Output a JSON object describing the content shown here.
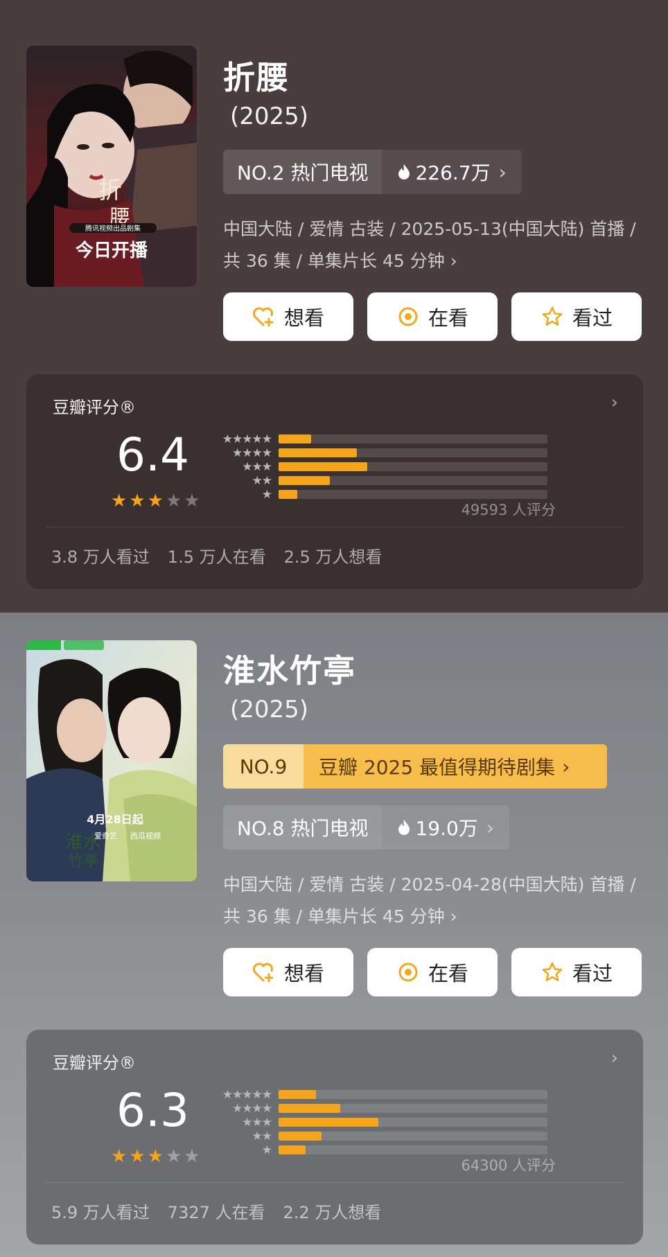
{
  "shows": [
    {
      "title": "折腰",
      "year": "(2025)",
      "poster": {
        "top_label": "腾讯视频出品剧集",
        "bottom_label": "今日开播"
      },
      "rank": {
        "left": "NO.2 热门电视",
        "heat": "226.7万"
      },
      "meta": "中国大陆 / 爱情 古装 / 2025-05-13(中国大陆) 首播 / 共 36 集 / 单集片长 45 分钟",
      "buttons": {
        "want": "想看",
        "watching": "在看",
        "watched": "看过"
      },
      "rating": {
        "header": "豆瓣评分®",
        "score": "6.4",
        "stars_filled": 3,
        "distribution": [
          0.12,
          0.29,
          0.33,
          0.19,
          0.07
        ],
        "votes": "49593 人评分",
        "watched": "3.8 万人看过",
        "watching": "1.5 万人在看",
        "want": "2.5 万人想看"
      }
    },
    {
      "title": "淮水竹亭",
      "year": "(2025)",
      "poster": {
        "date_label": "4月28日起",
        "platform": "爱奇艺",
        "partner": "西瓜视频"
      },
      "expect": {
        "left": "NO.9",
        "right": "豆瓣 2025 最值得期待剧集"
      },
      "rank": {
        "left": "NO.8 热门电视",
        "heat": "19.0万"
      },
      "meta": "中国大陆 / 爱情 古装 / 2025-04-28(中国大陆) 首播 / 共 36 集 / 单集片长 45 分钟",
      "buttons": {
        "want": "想看",
        "watching": "在看",
        "watched": "看过"
      },
      "rating": {
        "header": "豆瓣评分®",
        "score": "6.3",
        "stars_filled": 3,
        "distribution": [
          0.14,
          0.23,
          0.37,
          0.16,
          0.1
        ],
        "votes": "64300 人评分",
        "watched": "5.9 万人看过",
        "watching": "7327 人在看",
        "want": "2.2 万人想看"
      }
    }
  ],
  "colors": {
    "accent": "#f5a51c",
    "section1_bg": "#4a3d3d",
    "section2_bg": "#8b8d91"
  },
  "icons": {
    "heat": "flame-icon",
    "want": "heart-plus-icon",
    "watching": "target-icon",
    "watched": "star-outline-icon",
    "more": "chevron-right-icon"
  }
}
